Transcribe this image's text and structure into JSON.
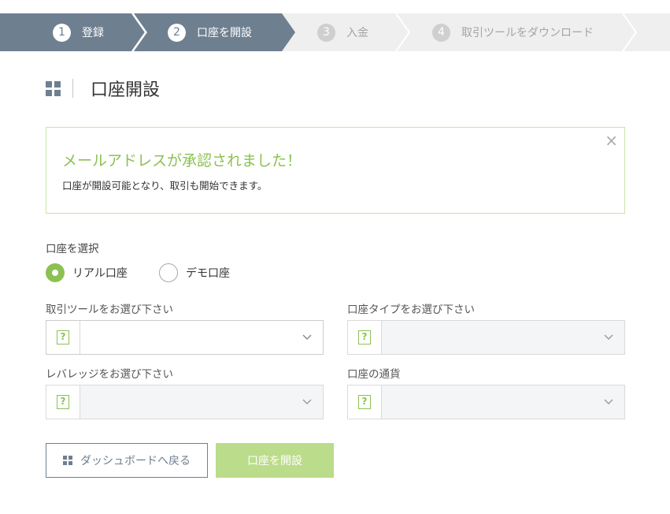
{
  "stepper": {
    "steps": [
      {
        "num": "1",
        "label": "登録"
      },
      {
        "num": "2",
        "label": "口座を開設"
      },
      {
        "num": "3",
        "label": "入金"
      },
      {
        "num": "4",
        "label": "取引ツールをダウンロード"
      }
    ],
    "active_color": "#6e7f90",
    "inactive_color": "#efefef"
  },
  "page": {
    "title": "口座開設",
    "title_icon": "grid-icon"
  },
  "alert": {
    "headline": "メールアドレスが承認されました！",
    "body": "口座が開設可能となり、取引も開始できます。",
    "close_symbol": "×",
    "accent_color": "#8cc152"
  },
  "account_select": {
    "label": "口座を選択",
    "options": [
      {
        "label": "リアル口座",
        "selected": true
      },
      {
        "label": "デモ口座",
        "selected": false
      }
    ]
  },
  "fields": {
    "platform": {
      "label": "取引ツールをお選び下さい",
      "value": "",
      "help": "?",
      "disabled": false
    },
    "account_type": {
      "label": "口座タイプをお選び下さい",
      "value": "",
      "help": "?",
      "disabled": true
    },
    "leverage": {
      "label": "レバレッジをお選び下さい",
      "value": "",
      "help": "?",
      "disabled": true
    },
    "currency": {
      "label": "口座の通貨",
      "value": "",
      "help": "?",
      "disabled": true
    }
  },
  "buttons": {
    "back": "ダッシュボードへ戻る",
    "open": "口座を開設"
  }
}
